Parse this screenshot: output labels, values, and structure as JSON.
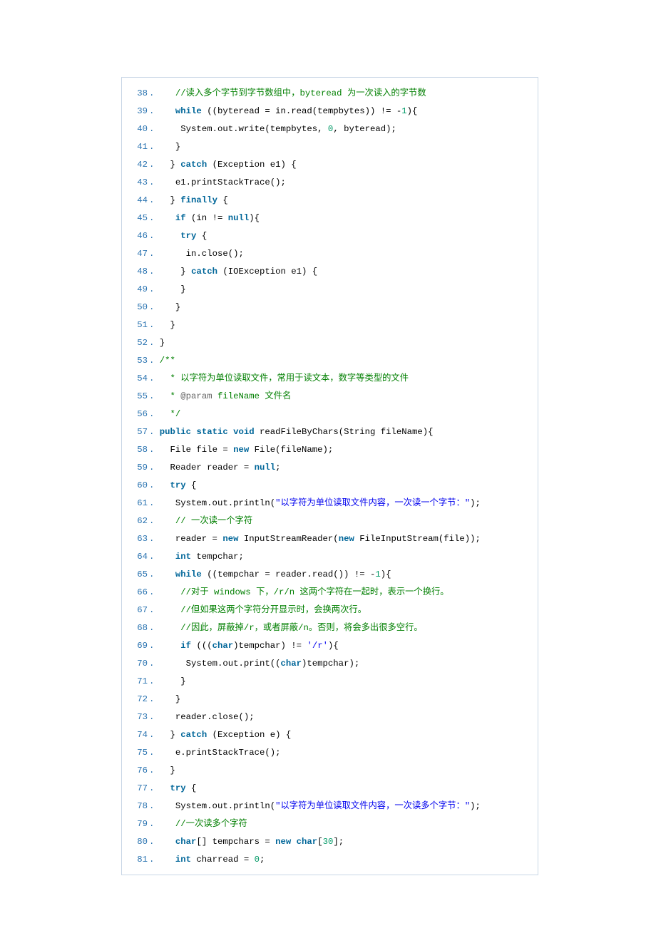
{
  "lines": [
    {
      "n": 38,
      "tokens": [
        [
          "w",
          "   "
        ],
        [
          "cmt",
          "//读入多个字节到字节数组中，byteread 为一次读入的字节数"
        ]
      ]
    },
    {
      "n": 39,
      "tokens": [
        [
          "w",
          "   "
        ],
        [
          "kw",
          "while"
        ],
        [
          "p",
          " ((byteread = in.read(tempbytes)) != -"
        ],
        [
          "num",
          "1"
        ],
        [
          "p",
          "){"
        ]
      ]
    },
    {
      "n": 40,
      "tokens": [
        [
          "w",
          "    "
        ],
        [
          "p",
          "System.out.write(tempbytes, "
        ],
        [
          "num",
          "0"
        ],
        [
          "p",
          ", byteread);"
        ]
      ]
    },
    {
      "n": 41,
      "tokens": [
        [
          "w",
          "   "
        ],
        [
          "p",
          "}"
        ]
      ]
    },
    {
      "n": 42,
      "tokens": [
        [
          "w",
          "  "
        ],
        [
          "p",
          "} "
        ],
        [
          "kw",
          "catch"
        ],
        [
          "p",
          " (Exception e1) {"
        ]
      ]
    },
    {
      "n": 43,
      "tokens": [
        [
          "w",
          "   "
        ],
        [
          "p",
          "e1.printStackTrace();"
        ]
      ]
    },
    {
      "n": 44,
      "tokens": [
        [
          "w",
          "  "
        ],
        [
          "p",
          "} "
        ],
        [
          "kw",
          "finally"
        ],
        [
          "p",
          " {"
        ]
      ]
    },
    {
      "n": 45,
      "tokens": [
        [
          "w",
          "   "
        ],
        [
          "kw",
          "if"
        ],
        [
          "p",
          " (in != "
        ],
        [
          "kw",
          "null"
        ],
        [
          "p",
          "){"
        ]
      ]
    },
    {
      "n": 46,
      "tokens": [
        [
          "w",
          "    "
        ],
        [
          "kw",
          "try"
        ],
        [
          "p",
          " {"
        ]
      ]
    },
    {
      "n": 47,
      "tokens": [
        [
          "w",
          "     "
        ],
        [
          "p",
          "in.close();"
        ]
      ]
    },
    {
      "n": 48,
      "tokens": [
        [
          "w",
          "    "
        ],
        [
          "p",
          "} "
        ],
        [
          "kw",
          "catch"
        ],
        [
          "p",
          " (IOException e1) {"
        ]
      ]
    },
    {
      "n": 49,
      "tokens": [
        [
          "w",
          "    "
        ],
        [
          "p",
          "}"
        ]
      ]
    },
    {
      "n": 50,
      "tokens": [
        [
          "w",
          "   "
        ],
        [
          "p",
          "}"
        ]
      ]
    },
    {
      "n": 51,
      "tokens": [
        [
          "w",
          "  "
        ],
        [
          "p",
          "}"
        ]
      ]
    },
    {
      "n": 52,
      "tokens": [
        [
          "p",
          "}"
        ]
      ]
    },
    {
      "n": 53,
      "tokens": [
        [
          "cmt",
          "/**"
        ]
      ]
    },
    {
      "n": 54,
      "tokens": [
        [
          "w",
          "  "
        ],
        [
          "cmt",
          "* 以字符为单位读取文件，常用于读文本，数字等类型的文件"
        ]
      ]
    },
    {
      "n": 55,
      "tokens": [
        [
          "w",
          "  "
        ],
        [
          "cmt",
          "* "
        ],
        [
          "ann",
          "@param"
        ],
        [
          "cmt",
          " fileName 文件名"
        ]
      ]
    },
    {
      "n": 56,
      "tokens": [
        [
          "w",
          "  "
        ],
        [
          "cmt",
          "*/"
        ]
      ]
    },
    {
      "n": 57,
      "tokens": [
        [
          "kw",
          "public"
        ],
        [
          "p",
          " "
        ],
        [
          "kw",
          "static"
        ],
        [
          "p",
          " "
        ],
        [
          "kw",
          "void"
        ],
        [
          "p",
          " readFileByChars(String fileName){"
        ]
      ]
    },
    {
      "n": 58,
      "tokens": [
        [
          "w",
          "  "
        ],
        [
          "p",
          "File file = "
        ],
        [
          "kw",
          "new"
        ],
        [
          "p",
          " File(fileName);"
        ]
      ]
    },
    {
      "n": 59,
      "tokens": [
        [
          "w",
          "  "
        ],
        [
          "p",
          "Reader reader = "
        ],
        [
          "kw",
          "null"
        ],
        [
          "p",
          ";"
        ]
      ]
    },
    {
      "n": 60,
      "tokens": [
        [
          "w",
          "  "
        ],
        [
          "kw",
          "try"
        ],
        [
          "p",
          " {"
        ]
      ]
    },
    {
      "n": 61,
      "tokens": [
        [
          "w",
          "   "
        ],
        [
          "p",
          "System.out.println("
        ],
        [
          "str",
          "\"以字符为单位读取文件内容，一次读一个字节：\""
        ],
        [
          "p",
          ");"
        ]
      ]
    },
    {
      "n": 62,
      "tokens": [
        [
          "w",
          "   "
        ],
        [
          "cmt",
          "// 一次读一个字符"
        ]
      ]
    },
    {
      "n": 63,
      "tokens": [
        [
          "w",
          "   "
        ],
        [
          "p",
          "reader = "
        ],
        [
          "kw",
          "new"
        ],
        [
          "p",
          " InputStreamReader("
        ],
        [
          "kw",
          "new"
        ],
        [
          "p",
          " FileInputStream(file));"
        ]
      ]
    },
    {
      "n": 64,
      "tokens": [
        [
          "w",
          "   "
        ],
        [
          "kw",
          "int"
        ],
        [
          "p",
          " tempchar;"
        ]
      ]
    },
    {
      "n": 65,
      "tokens": [
        [
          "w",
          "   "
        ],
        [
          "kw",
          "while"
        ],
        [
          "p",
          " ((tempchar = reader.read()) != -"
        ],
        [
          "num",
          "1"
        ],
        [
          "p",
          "){"
        ]
      ]
    },
    {
      "n": 66,
      "tokens": [
        [
          "w",
          "    "
        ],
        [
          "cmt",
          "//对于 windows 下，/r/n 这两个字符在一起时，表示一个换行。"
        ]
      ]
    },
    {
      "n": 67,
      "tokens": [
        [
          "w",
          "    "
        ],
        [
          "cmt",
          "//但如果这两个字符分开显示时，会换两次行。"
        ]
      ]
    },
    {
      "n": 68,
      "tokens": [
        [
          "w",
          "    "
        ],
        [
          "cmt",
          "//因此，屏蔽掉/r，或者屏蔽/n。否则，将会多出很多空行。"
        ]
      ]
    },
    {
      "n": 69,
      "tokens": [
        [
          "w",
          "    "
        ],
        [
          "kw",
          "if"
        ],
        [
          "p",
          " ((("
        ],
        [
          "kw",
          "char"
        ],
        [
          "p",
          ")tempchar) != "
        ],
        [
          "str",
          "'/r'"
        ],
        [
          "p",
          "){"
        ]
      ]
    },
    {
      "n": 70,
      "tokens": [
        [
          "w",
          "     "
        ],
        [
          "p",
          "System.out.print(("
        ],
        [
          "kw",
          "char"
        ],
        [
          "p",
          ")tempchar);"
        ]
      ]
    },
    {
      "n": 71,
      "tokens": [
        [
          "w",
          "    "
        ],
        [
          "p",
          "}"
        ]
      ]
    },
    {
      "n": 72,
      "tokens": [
        [
          "w",
          "   "
        ],
        [
          "p",
          "}"
        ]
      ]
    },
    {
      "n": 73,
      "tokens": [
        [
          "w",
          "   "
        ],
        [
          "p",
          "reader.close();"
        ]
      ]
    },
    {
      "n": 74,
      "tokens": [
        [
          "w",
          "  "
        ],
        [
          "p",
          "} "
        ],
        [
          "kw",
          "catch"
        ],
        [
          "p",
          " (Exception e) {"
        ]
      ]
    },
    {
      "n": 75,
      "tokens": [
        [
          "w",
          "   "
        ],
        [
          "p",
          "e.printStackTrace();"
        ]
      ]
    },
    {
      "n": 76,
      "tokens": [
        [
          "w",
          "  "
        ],
        [
          "p",
          "}"
        ]
      ]
    },
    {
      "n": 77,
      "tokens": [
        [
          "w",
          "  "
        ],
        [
          "kw",
          "try"
        ],
        [
          "p",
          " {"
        ]
      ]
    },
    {
      "n": 78,
      "tokens": [
        [
          "w",
          "   "
        ],
        [
          "p",
          "System.out.println("
        ],
        [
          "str",
          "\"以字符为单位读取文件内容，一次读多个字节：\""
        ],
        [
          "p",
          ");"
        ]
      ]
    },
    {
      "n": 79,
      "tokens": [
        [
          "w",
          "   "
        ],
        [
          "cmt",
          "//一次读多个字符"
        ]
      ]
    },
    {
      "n": 80,
      "tokens": [
        [
          "w",
          "   "
        ],
        [
          "kw",
          "char"
        ],
        [
          "p",
          "[] tempchars = "
        ],
        [
          "kw",
          "new"
        ],
        [
          "p",
          " "
        ],
        [
          "kw",
          "char"
        ],
        [
          "p",
          "["
        ],
        [
          "num",
          "30"
        ],
        [
          "p",
          "];"
        ]
      ]
    },
    {
      "n": 81,
      "tokens": [
        [
          "w",
          "   "
        ],
        [
          "kw",
          "int"
        ],
        [
          "p",
          " charread = "
        ],
        [
          "num",
          "0"
        ],
        [
          "p",
          ";"
        ]
      ]
    }
  ]
}
